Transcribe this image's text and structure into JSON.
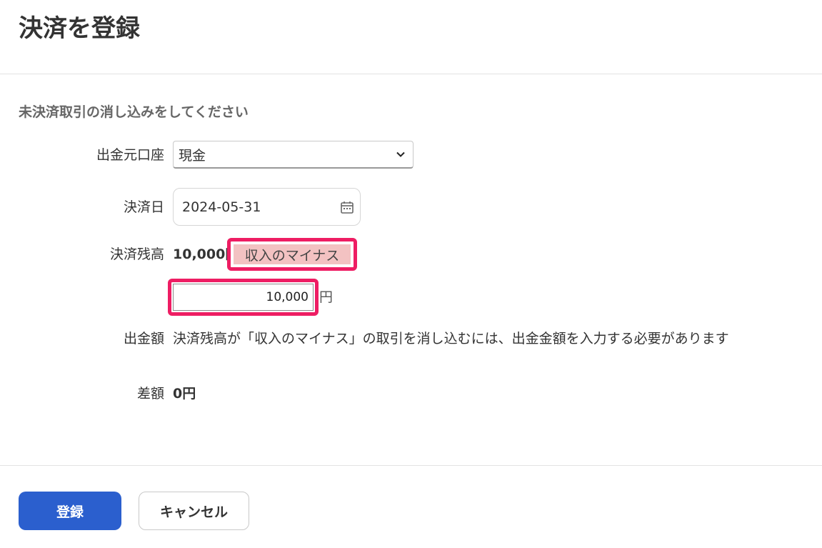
{
  "page": {
    "title": "決済を登録"
  },
  "form": {
    "instruction": "未決済取引の消し込みをしてください",
    "account": {
      "label": "出金元口座",
      "value": "現金"
    },
    "date": {
      "label": "決済日",
      "value": "2024-05-31"
    },
    "balance": {
      "label": "決済残高",
      "value": "10,000円",
      "badge": "収入のマイナス"
    },
    "amount": {
      "value": "10,000",
      "unit": "円"
    },
    "withdrawal": {
      "label": "出金額",
      "help": "決済残高が「収入のマイナス」の取引を消し込むには、出金金額を入力する必要があります"
    },
    "difference": {
      "label": "差額",
      "value": "0円"
    }
  },
  "actions": {
    "submit_label": "登録",
    "cancel_label": "キャンセル"
  },
  "colors": {
    "primary": "#2b5fce",
    "highlight_border": "#ee1d63",
    "badge_bg": "#f3c2c2"
  },
  "icons": {
    "select": "chevron-down-icon",
    "date": "calendar-icon"
  }
}
